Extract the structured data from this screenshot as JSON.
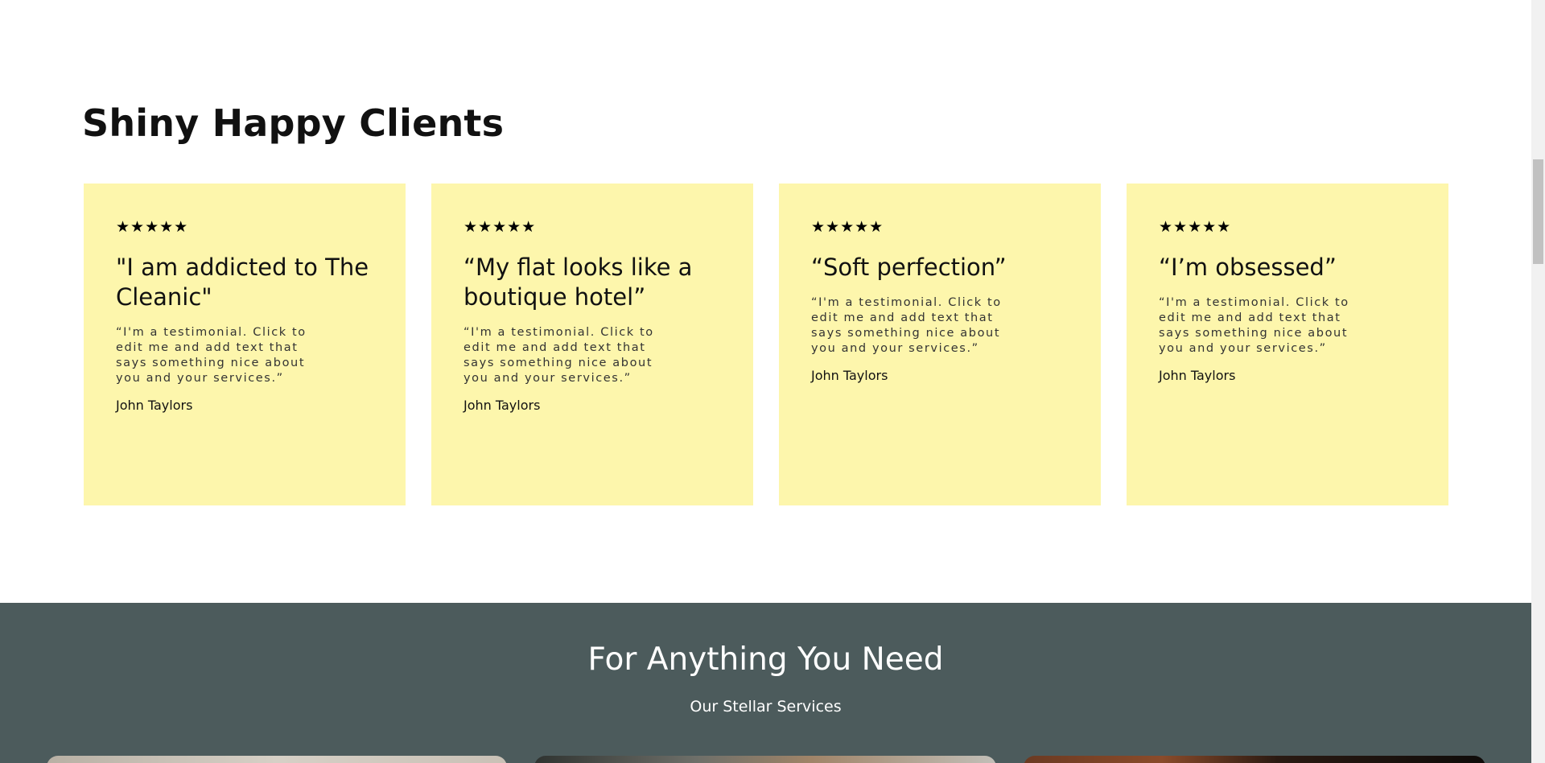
{
  "testimonials": {
    "title": "Shiny Happy Clients",
    "cards": [
      {
        "stars": "★★★★★",
        "headline": "\"I am addicted to The Cleanic\"",
        "body": "“I'm a testimonial. Click to edit me and add text that says something nice about you and your services.”",
        "author": "John Taylors"
      },
      {
        "stars": "★★★★★",
        "headline": "“My flat looks like a boutique hotel”",
        "body": "“I'm a testimonial. Click to edit me and add text that says something nice about you and your services.”",
        "author": "John Taylors"
      },
      {
        "stars": "★★★★★",
        "headline": "“Soft perfection”",
        "body": "“I'm a testimonial. Click to edit me and add text that says something nice about you and your services.”",
        "author": "John Taylors"
      },
      {
        "stars": "★★★★★",
        "headline": "“I’m obsessed”",
        "body": "“I'm a testimonial. Click to edit me and add text that says something nice about you and your services.”",
        "author": "John Taylors"
      }
    ],
    "card_color": "#fdf6ac"
  },
  "services": {
    "title": "For Anything You Need",
    "subtitle": "Our Stellar Services",
    "background_color": "#4c5b5c"
  }
}
